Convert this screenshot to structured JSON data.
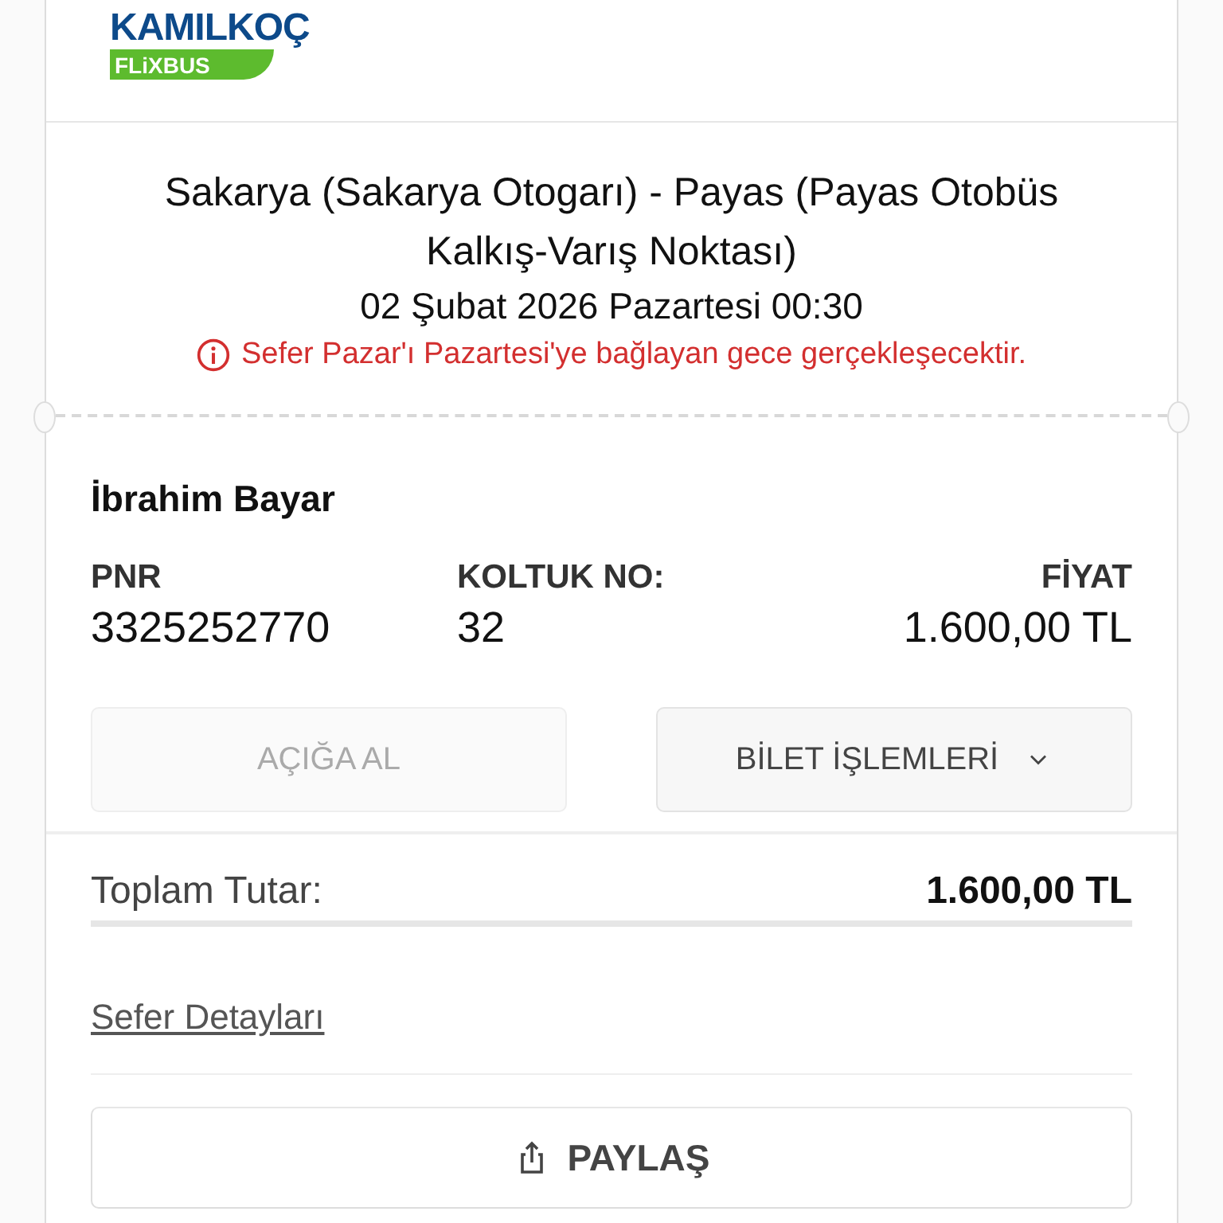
{
  "logo": {
    "brand": "KAMILKOÇ",
    "sub": "FLiXBUS"
  },
  "trip": {
    "route": "Sakarya (Sakarya Otogarı) - Payas (Payas Otobüs Kalkış-Varış Noktası)",
    "date": "02 Şubat 2026 Pazartesi 00:30",
    "warning": "Sefer Pazar'ı Pazartesi'ye bağlayan gece gerçekleşecektir."
  },
  "passenger": {
    "name": "İbrahim Bayar",
    "fields": [
      {
        "label": "PNR",
        "value": "3325252770"
      },
      {
        "label": "KOLTUK NO:",
        "value": "32"
      },
      {
        "label": "FİYAT",
        "value": "1.600,00 TL"
      }
    ]
  },
  "actions": [
    {
      "label": "AÇIĞA AL",
      "disabled": true,
      "kind": "plain"
    },
    {
      "label": "BİLET İŞLEMLERİ",
      "disabled": false,
      "kind": "dropdown"
    }
  ],
  "total": {
    "label": "Toplam Tutar:",
    "value": "1.600,00 TL"
  },
  "details_link": "Sefer Detayları",
  "share_button": "PAYLAŞ"
}
